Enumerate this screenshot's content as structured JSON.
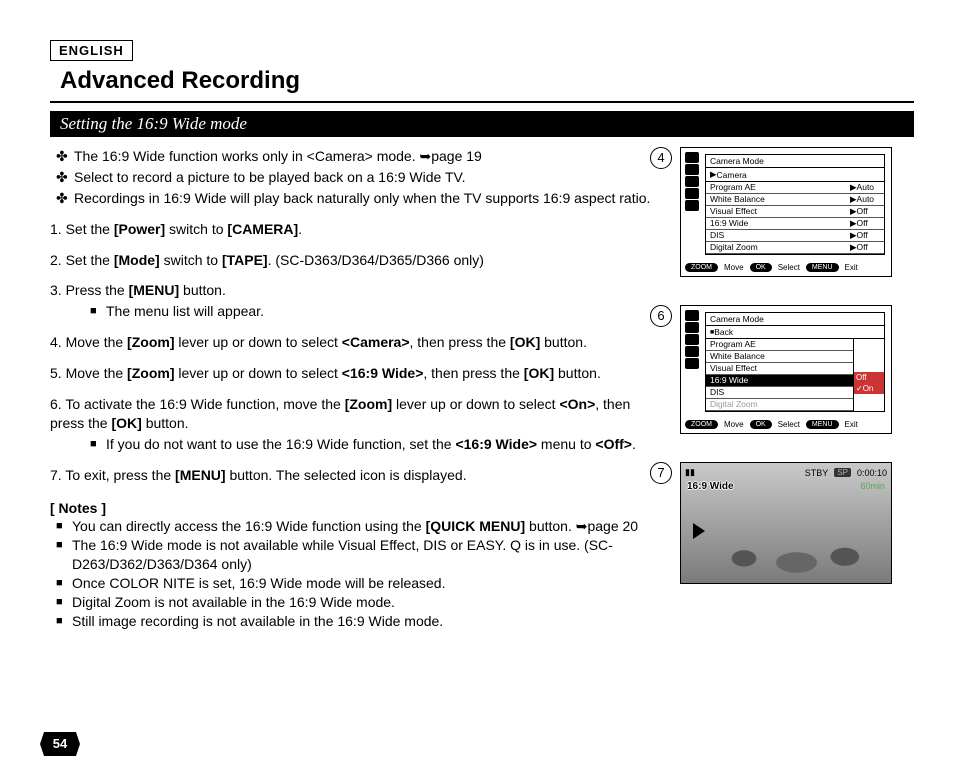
{
  "lang": "ENGLISH",
  "title": "Advanced Recording",
  "section": "Setting the 16:9 Wide mode",
  "intro": [
    "The 16:9 Wide function works only in <Camera> mode. ➥page 19",
    "Select to record a picture to be played back on a 16:9 Wide TV.",
    "Recordings in 16:9 Wide will play back naturally only when the TV supports 16:9 aspect ratio."
  ],
  "steps": {
    "s1a": "1. Set the ",
    "s1b": "[Power]",
    "s1c": " switch to ",
    "s1d": "[CAMERA]",
    "s1e": ".",
    "s2a": "2. Set the ",
    "s2b": "[Mode]",
    "s2c": " switch to ",
    "s2d": "[TAPE]",
    "s2e": ". (SC-D363/D364/D365/D366 only)",
    "s3a": "3. Press the ",
    "s3b": "[MENU]",
    "s3c": " button.",
    "s3sub": "The menu list will appear.",
    "s4a": "4. Move the ",
    "s4b": "[Zoom]",
    "s4c": " lever up or down to select ",
    "s4d": "<Camera>",
    "s4e": ", then press the ",
    "s4f": "[OK]",
    "s4g": " button.",
    "s5a": "5. Move the ",
    "s5b": "[Zoom]",
    "s5c": " lever up or down to select ",
    "s5d": "<16:9 Wide>",
    "s5e": ", then press the ",
    "s5f": "[OK]",
    "s5g": " button.",
    "s6a": "6. To activate the 16:9 Wide function, move the ",
    "s6b": "[Zoom]",
    "s6c": " lever up or down to select ",
    "s6d": "<On>",
    "s6e": ", then press the ",
    "s6f": "[OK]",
    "s6g": " button.",
    "s6suba": "If you do not want to use the 16:9 Wide function, set the ",
    "s6subb": "<16:9 Wide>",
    "s6subc": " menu to ",
    "s6subd": "<Off>",
    "s6sube": ".",
    "s7a": "7. To exit, press the ",
    "s7b": "[MENU]",
    "s7c": " button. The selected icon is displayed."
  },
  "notes_head": "[ Notes ]",
  "notes": {
    "n1a": "You can directly access the 16:9 Wide function using the ",
    "n1b": "[QUICK MENU]",
    "n1c": " button. ➥page 20",
    "n2": "The 16:9 Wide mode is not available while Visual Effect, DIS or EASY. Q is in use. (SC-D263/D362/D363/D364 only)",
    "n3": "Once COLOR NITE is set, 16:9 Wide mode will be released.",
    "n4": "Digital Zoom is not available in the 16:9 Wide mode.",
    "n5": "Still image recording is not available in the 16:9 Wide mode."
  },
  "page_num": "54",
  "panel4": {
    "step": "4",
    "title": "Camera Mode",
    "sub": "Camera",
    "rows": [
      {
        "k": "Program AE",
        "v": "Auto"
      },
      {
        "k": "White Balance",
        "v": "Auto"
      },
      {
        "k": "Visual Effect",
        "v": "Off"
      },
      {
        "k": "16:9 Wide",
        "v": "Off"
      },
      {
        "k": "DIS",
        "v": "Off"
      },
      {
        "k": "Digital Zoom",
        "v": "Off"
      }
    ],
    "foot": {
      "zoom": "ZOOM",
      "move": "Move",
      "ok": "OK",
      "select": "Select",
      "menu": "MENU",
      "exit": "Exit"
    }
  },
  "panel6": {
    "step": "6",
    "title": "Camera Mode",
    "sub": "Back",
    "rows": [
      {
        "k": "Program AE"
      },
      {
        "k": "White Balance"
      },
      {
        "k": "Visual Effect"
      },
      {
        "k": "16:9 Wide",
        "sel": true,
        "opt": "Off"
      },
      {
        "k": "DIS",
        "opt": "On",
        "chk": true
      },
      {
        "k": "Digital Zoom",
        "dim": true
      }
    ],
    "foot": {
      "zoom": "ZOOM",
      "move": "Move",
      "ok": "OK",
      "select": "Select",
      "menu": "MENU",
      "exit": "Exit"
    }
  },
  "panel7": {
    "step": "7",
    "stby": "STBY",
    "sp": "SP",
    "time": "0:00:10",
    "remain": "60min",
    "wide": "16:9 Wide"
  }
}
